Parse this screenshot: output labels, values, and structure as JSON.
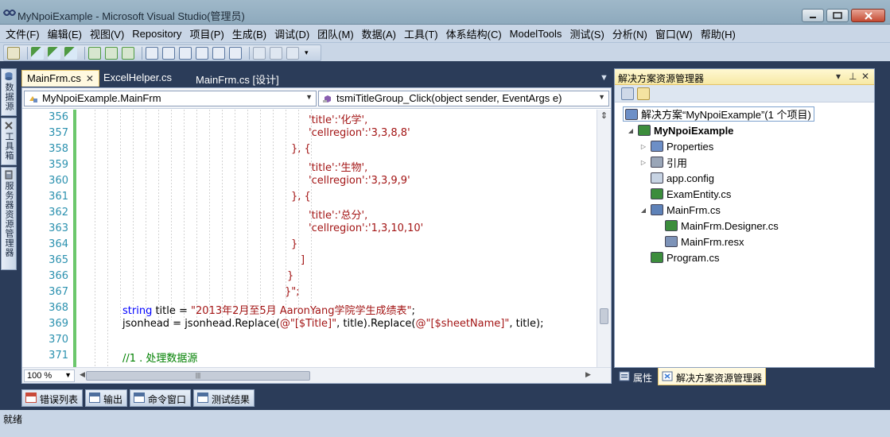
{
  "window": {
    "title": "MyNpoiExample - Microsoft Visual Studio(管理员)",
    "colors": {
      "accent": "#e5c365",
      "background": "#2b3c59",
      "tab_active": "#fff9e0"
    }
  },
  "menu": [
    "文件(F)",
    "编辑(E)",
    "视图(V)",
    "Repository",
    "项目(P)",
    "生成(B)",
    "调试(D)",
    "团队(M)",
    "数据(A)",
    "工具(T)",
    "体系结构(C)",
    "ModelTools",
    "测试(S)",
    "分析(N)",
    "窗口(W)",
    "帮助(H)"
  ],
  "left_dock": [
    {
      "label": "数据源",
      "icon": "database-icon"
    },
    {
      "label": "工具箱",
      "icon": "toolbox-icon"
    },
    {
      "label": "服务器资源管理器",
      "icon": "server-explorer-icon"
    }
  ],
  "doc_tabs": [
    {
      "label": "MainFrm.cs",
      "active": true
    },
    {
      "label": "ExcelHelper.cs",
      "active": false
    },
    {
      "label": "MainFrm.cs [设计]",
      "active": false
    }
  ],
  "nav": {
    "class_selector": "MyNpoiExample.MainFrm",
    "member_selector": "tsmiTitleGroup_Click(object sender, EventArgs e)"
  },
  "code_lines": [
    {
      "num": "356",
      "parts": [
        {
          "t": "'title':'化学',",
          "c": "str"
        }
      ],
      "indent": 360
    },
    {
      "num": "357",
      "parts": [
        {
          "t": "'cellregion':'3,3,8,8'",
          "c": "str"
        }
      ],
      "indent": 360
    },
    {
      "num": "358",
      "parts": [
        {
          "t": "}, {",
          "c": "str"
        }
      ],
      "indent": 338
    },
    {
      "num": "359",
      "parts": [
        {
          "t": "'title':'生物',",
          "c": "str"
        }
      ],
      "indent": 360
    },
    {
      "num": "360",
      "parts": [
        {
          "t": "'cellregion':'3,3,9,9'",
          "c": "str"
        }
      ],
      "indent": 360
    },
    {
      "num": "361",
      "parts": [
        {
          "t": "}, {",
          "c": "str"
        }
      ],
      "indent": 338
    },
    {
      "num": "362",
      "parts": [
        {
          "t": "'title':'总分',",
          "c": "str"
        }
      ],
      "indent": 360
    },
    {
      "num": "363",
      "parts": [
        {
          "t": "'cellregion':'1,3,10,10'",
          "c": "str"
        }
      ],
      "indent": 360
    },
    {
      "num": "364",
      "parts": [
        {
          "t": "}",
          "c": "str"
        }
      ],
      "indent": 338
    },
    {
      "num": "365",
      "parts": [
        {
          "t": "]",
          "c": "str"
        }
      ],
      "indent": 350
    },
    {
      "num": "366",
      "parts": [
        {
          "t": "}",
          "c": "str"
        }
      ],
      "indent": 333
    },
    {
      "num": "367",
      "parts": [
        {
          "t": "}\";",
          "c": "str"
        }
      ],
      "indent": 330
    },
    {
      "num": "368",
      "parts": [
        {
          "t": "string",
          "c": "kw"
        },
        {
          "t": " title = ",
          "c": ""
        },
        {
          "t": "\"2013年2月至5月 AaronYang学院学生成绩表\"",
          "c": "str"
        },
        {
          "t": ";",
          "c": ""
        }
      ],
      "indent": 126
    },
    {
      "num": "369",
      "parts": [
        {
          "t": "jsonhead = jsonhead.Replace(",
          "c": ""
        },
        {
          "t": "@\"[$Title]\"",
          "c": "str"
        },
        {
          "t": ", title).Replace(",
          "c": ""
        },
        {
          "t": "@\"[$sheetName]\"",
          "c": "str"
        },
        {
          "t": ", title);",
          "c": ""
        }
      ],
      "indent": 126
    },
    {
      "num": "370",
      "parts": [],
      "indent": 126
    },
    {
      "num": "371",
      "parts": [
        {
          "t": "//1 . 处理数据源",
          "c": "cm"
        }
      ],
      "indent": 126
    }
  ],
  "editor_footer": {
    "zoom": "100 %"
  },
  "solution_explorer": {
    "title": "解决方案资源管理器",
    "nodes": [
      {
        "label": "解决方案“MyNpoiExample”(1 个项目)",
        "level": 0,
        "toggle": "",
        "icon": "solution-icon",
        "style": "sol"
      },
      {
        "label": "MyNpoiExample",
        "level": 1,
        "toggle": "◢",
        "icon": "csharp-project-icon",
        "style": "bold"
      },
      {
        "label": "Properties",
        "level": 2,
        "toggle": "▷",
        "icon": "properties-folder-icon",
        "style": ""
      },
      {
        "label": "引用",
        "level": 2,
        "toggle": "▷",
        "icon": "references-icon",
        "style": ""
      },
      {
        "label": "app.config",
        "level": 2,
        "toggle": "",
        "icon": "config-file-icon",
        "style": ""
      },
      {
        "label": "ExamEntity.cs",
        "level": 2,
        "toggle": "",
        "icon": "cs-file-icon",
        "style": ""
      },
      {
        "label": "MainFrm.cs",
        "level": 2,
        "toggle": "◢",
        "icon": "form-file-icon",
        "style": ""
      },
      {
        "label": "MainFrm.Designer.cs",
        "level": 3,
        "toggle": "",
        "icon": "cs-file-icon",
        "style": ""
      },
      {
        "label": "MainFrm.resx",
        "level": 3,
        "toggle": "",
        "icon": "resx-file-icon",
        "style": ""
      },
      {
        "label": "Program.cs",
        "level": 2,
        "toggle": "",
        "icon": "cs-file-icon",
        "style": ""
      }
    ]
  },
  "panel_tabs": [
    {
      "label": "属性",
      "active": false,
      "icon": "properties-icon"
    },
    {
      "label": "解决方案资源管理器",
      "active": true,
      "icon": "solution-explorer-icon"
    }
  ],
  "bottom_tabs": [
    {
      "label": "错误列表",
      "icon": "error-list-icon"
    },
    {
      "label": "输出",
      "icon": "output-icon"
    },
    {
      "label": "命令窗口",
      "icon": "command-window-icon"
    },
    {
      "label": "测试结果",
      "icon": "test-results-icon"
    }
  ],
  "status": {
    "text": "就绪"
  }
}
